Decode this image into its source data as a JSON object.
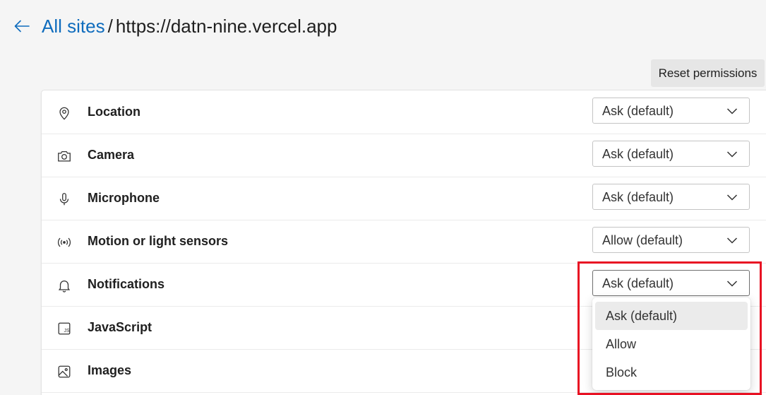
{
  "header": {
    "breadcrumb_link": "All sites",
    "separator": "/",
    "site": "https://datn-nine.vercel.app"
  },
  "reset_label": "Reset permissions",
  "permissions": [
    {
      "label": "Location",
      "value": "Ask (default)",
      "icon": "location-pin-icon"
    },
    {
      "label": "Camera",
      "value": "Ask (default)",
      "icon": "camera-icon"
    },
    {
      "label": "Microphone",
      "value": "Ask (default)",
      "icon": "microphone-icon"
    },
    {
      "label": "Motion or light sensors",
      "value": "Allow (default)",
      "icon": "sensor-icon"
    },
    {
      "label": "Notifications",
      "value": "Ask (default)",
      "icon": "bell-icon"
    },
    {
      "label": "JavaScript",
      "icon": "javascript-icon"
    },
    {
      "label": "Images",
      "icon": "image-icon"
    }
  ],
  "dropdown": {
    "options": [
      "Ask (default)",
      "Allow",
      "Block"
    ],
    "selected": "Ask (default)"
  },
  "colors": {
    "link": "#0f6cbd",
    "highlight": "#e81123"
  }
}
